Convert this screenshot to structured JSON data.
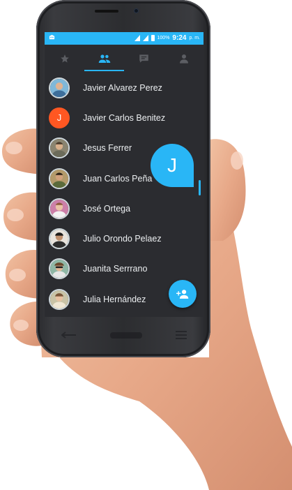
{
  "status_bar": {
    "battery_percent": "100%",
    "time": "9:24",
    "ampm": "p. m."
  },
  "tabs": [
    {
      "icon": "star-icon",
      "active": false
    },
    {
      "icon": "people-icon",
      "active": true
    },
    {
      "icon": "chat-icon",
      "active": false
    },
    {
      "icon": "person-icon",
      "active": false
    }
  ],
  "contacts": [
    {
      "name": "Javier Alvarez Perez",
      "avatar": "photo"
    },
    {
      "name": "Javier Carlos Benitez",
      "avatar": "letter",
      "initial": "J"
    },
    {
      "name": "Jesus Ferrer",
      "avatar": "photo"
    },
    {
      "name": "Juan Carlos Peña",
      "avatar": "photo"
    },
    {
      "name": "José Ortega",
      "avatar": "photo"
    },
    {
      "name": "Julio Orondo Pelaez",
      "avatar": "photo"
    },
    {
      "name": "Juanita Serrrano",
      "avatar": "photo"
    },
    {
      "name": "Julia Hernández",
      "avatar": "photo"
    }
  ],
  "section_bubble": "J",
  "fab": {
    "icon": "add-person-icon"
  },
  "colors": {
    "accent": "#29b6f6",
    "background": "#2b2c30",
    "letter_avatar": "#ff5722"
  }
}
